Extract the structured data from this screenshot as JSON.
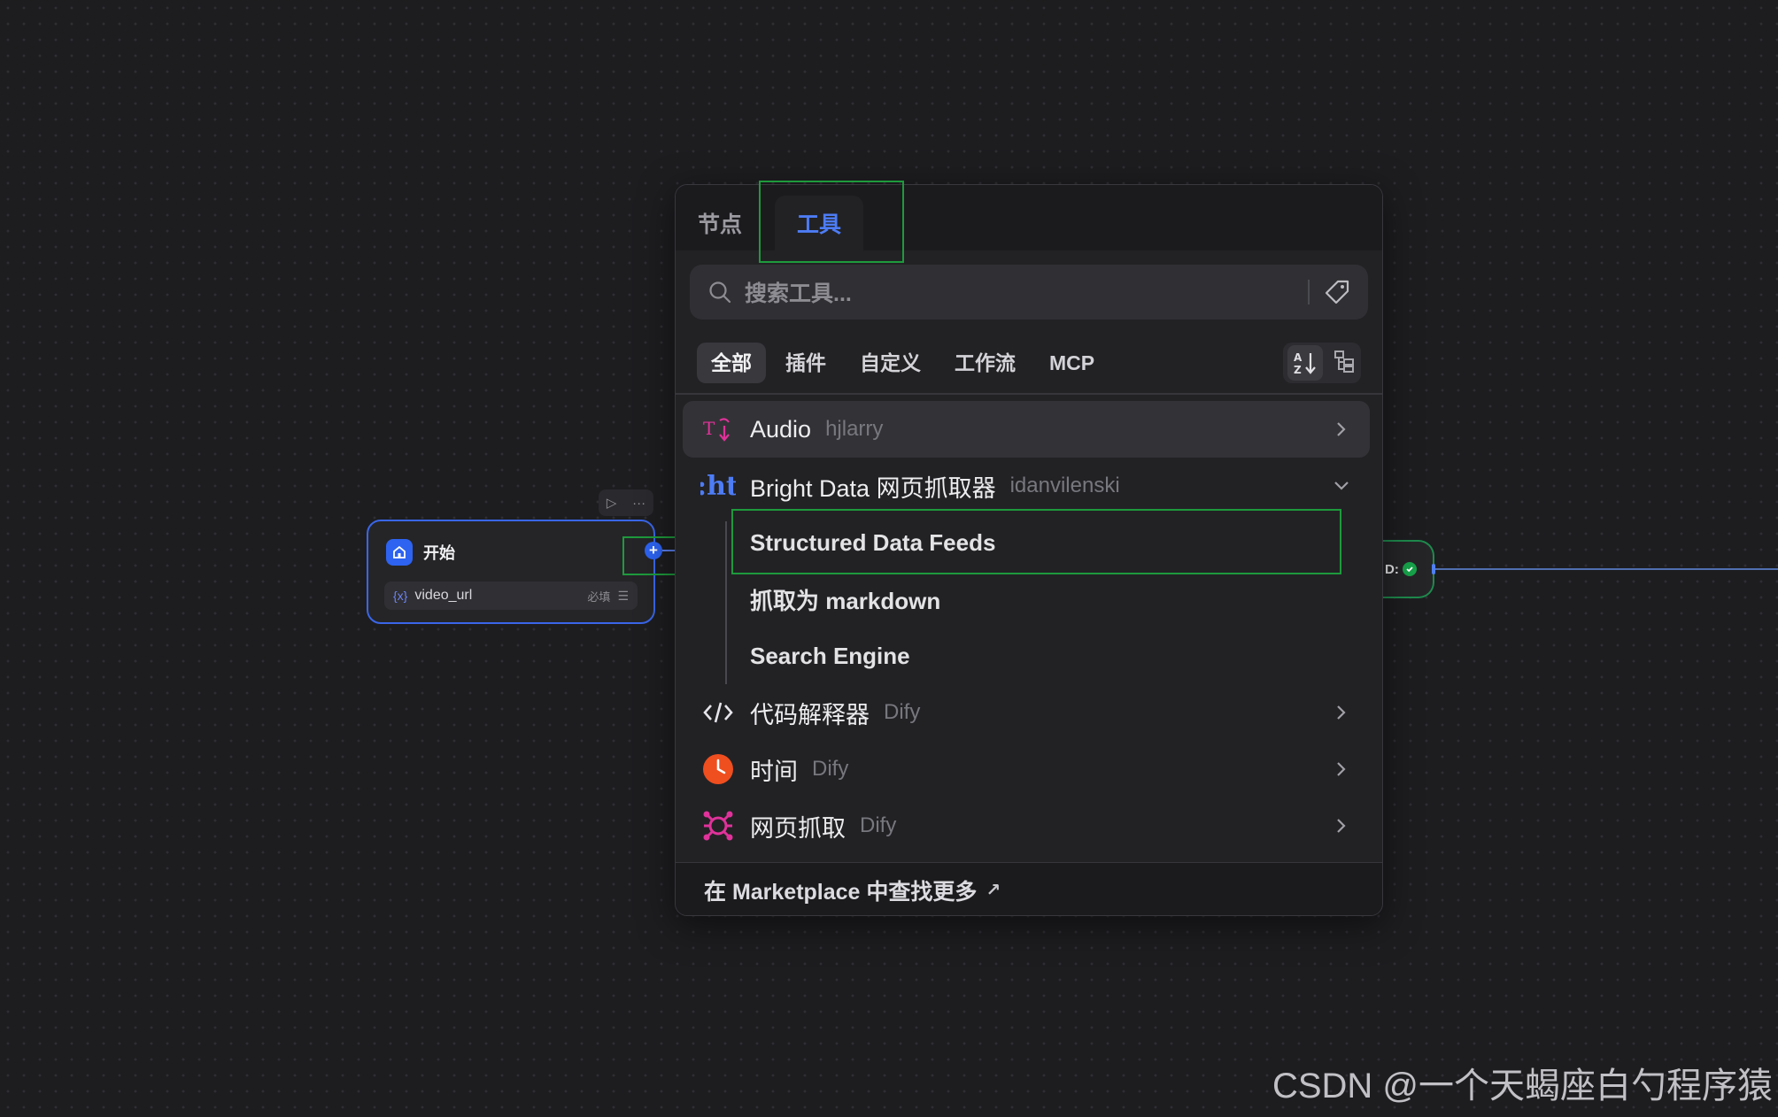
{
  "start_node": {
    "title": "开始",
    "variable": {
      "name": "video_url",
      "required_label": "必填"
    }
  },
  "right_node": {
    "label": "D:"
  },
  "panel": {
    "tabs": [
      {
        "label": "节点",
        "active": false
      },
      {
        "label": "工具",
        "active": true
      }
    ],
    "search": {
      "placeholder": "搜索工具..."
    },
    "filters": [
      "全部",
      "插件",
      "自定义",
      "工作流",
      "MCP"
    ],
    "active_filter": "全部",
    "tools": [
      {
        "name": "Audio",
        "author": "hjlarry",
        "icon": "audio-icon",
        "state": "collapsed"
      },
      {
        "name": "Bright Data 网页抓取器",
        "author": "idanvilenski",
        "icon": "bright-data-logo",
        "icon_text": ":ht",
        "state": "expanded",
        "actions": [
          "Structured Data Feeds",
          "抓取为 markdown",
          "Search Engine"
        ]
      },
      {
        "name": "代码解释器",
        "author": "Dify",
        "icon": "code-icon",
        "state": "collapsed"
      },
      {
        "name": "时间",
        "author": "Dify",
        "icon": "clock-icon",
        "state": "collapsed"
      },
      {
        "name": "网页抓取",
        "author": "Dify",
        "icon": "web-scraper-icon",
        "state": "collapsed"
      }
    ],
    "footer": {
      "label": "在 Marketplace 中查找更多",
      "arrow": "↗"
    }
  },
  "colors": {
    "accent": "#4d7cf5",
    "node_border": "#3a66e8",
    "highlight": "#1e9a3c",
    "audio_icon": "#e0329a",
    "clock_icon": "#ef4e1f",
    "web_icon": "#e0329a"
  },
  "watermark": "CSDN @一个天蝎座白勺程序猿"
}
